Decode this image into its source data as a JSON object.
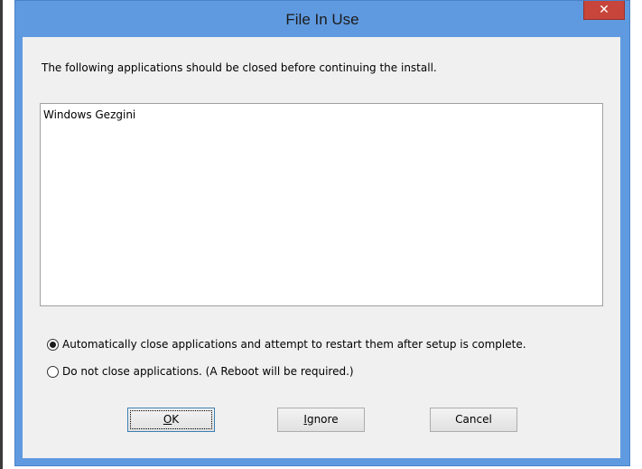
{
  "window": {
    "title": "File In Use",
    "close_glyph": "✕"
  },
  "dialog": {
    "message": "The following applications should be closed before continuing the install.",
    "applications": [
      "Windows Gezgini"
    ],
    "options": [
      {
        "label": "Automatically close applications and attempt to restart them after setup is complete.",
        "selected": true
      },
      {
        "label": "Do not close applications. (A Reboot will be required.)",
        "selected": false
      }
    ],
    "buttons": {
      "ok": {
        "access_key": "O",
        "rest": "K"
      },
      "ignore": {
        "access_key": "I",
        "rest": "gnore"
      },
      "cancel": {
        "label": "Cancel"
      }
    }
  },
  "colors": {
    "frame": "#5f9ae0",
    "close_button": "#c7453a",
    "client_background": "#f0f0f0"
  }
}
